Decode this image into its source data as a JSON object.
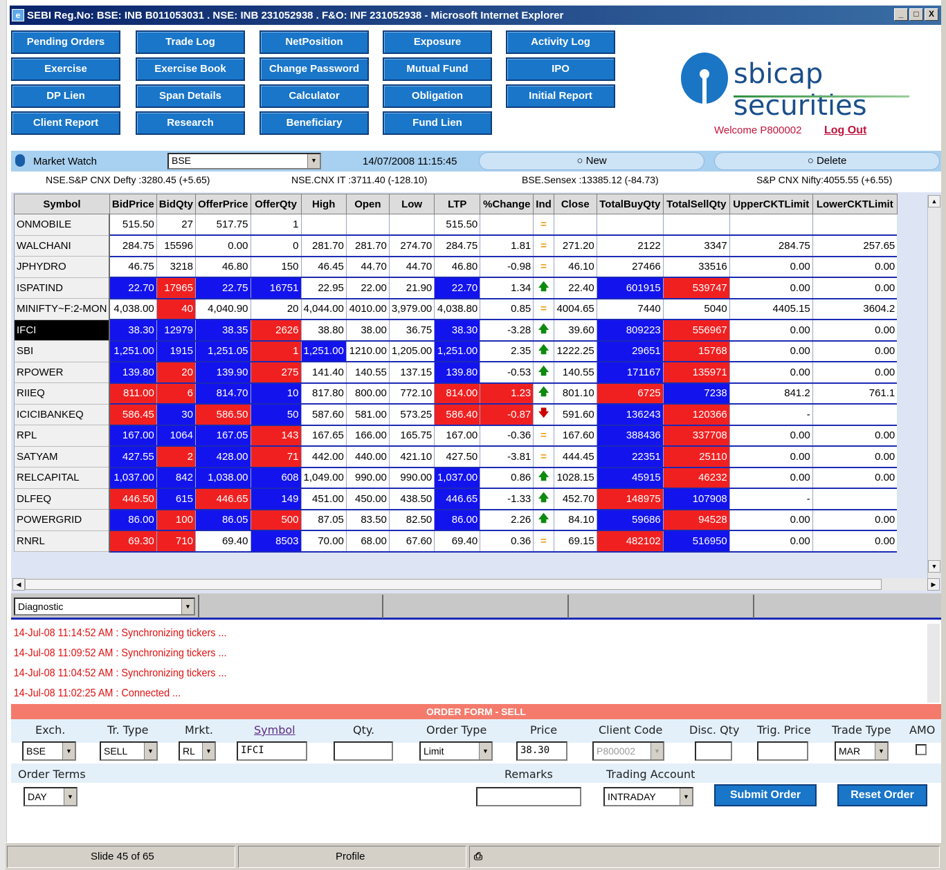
{
  "window": {
    "title": "SEBI Reg.No: BSE: INB B011053031 . NSE: INB 231052938 . F&O: INF 231052938 - Microsoft Internet Explorer",
    "controls": [
      "_",
      "□",
      "X"
    ]
  },
  "nav": {
    "buttons": [
      [
        "Pending Orders",
        "Trade Log",
        "NetPosition",
        "Exposure",
        "Activity Log"
      ],
      [
        "Exercise",
        "Exercise Book",
        "Change Password",
        "Mutual Fund",
        "IPO"
      ],
      [
        "DP Lien",
        "Span Details",
        "Calculator",
        "Obligation",
        "Initial Report"
      ],
      [
        "Client Report",
        "Research",
        "Beneficiary",
        "Fund Lien"
      ]
    ]
  },
  "brand": {
    "name": "sbicap securities"
  },
  "user": {
    "welcome": "Welcome P800002",
    "logout": "Log Out"
  },
  "market_watch": {
    "label": "Market Watch",
    "exchange": "BSE",
    "datetime": "14/07/2008 11:15:45",
    "new": "New",
    "delete": "Delete"
  },
  "indices": [
    "NSE.S&P CNX Defty :3280.45 (+5.65)",
    "NSE.CNX IT :3711.40 (-128.10)",
    "BSE.Sensex :13385.12 (-84.73)",
    "S&P CNX Nifty:4055.55 (+6.55)"
  ],
  "grid": {
    "columns": [
      "Symbol",
      "BidPrice",
      "BidQty",
      "OfferPrice",
      "OfferQty",
      "High",
      "Open",
      "Low",
      "LTP",
      "%Change",
      "Ind",
      "Close",
      "TotalBuyQty",
      "TotalSellQty",
      "UpperCKTLimit",
      "LowerCKTLimit"
    ],
    "rows": [
      [
        "ONMOBILE",
        "515.50",
        "27",
        "517.75",
        "1",
        "",
        "",
        "",
        "515.50",
        "",
        "eq",
        "",
        "",
        "",
        "",
        ""
      ],
      [
        "WALCHANI",
        "284.75",
        "15596",
        "0.00",
        "0",
        "281.70",
        "281.70",
        "274.70",
        "284.75",
        "1.81",
        "eq",
        "271.20",
        "2122",
        "3347",
        "284.75",
        "257.65"
      ],
      [
        "JPHYDRO",
        "46.75",
        "3218",
        "46.80",
        "150",
        "46.45",
        "44.70",
        "44.70",
        "46.80",
        "-0.98",
        "eq",
        "46.10",
        "27466",
        "33516",
        "0.00",
        "0.00"
      ],
      [
        "ISPATIND",
        "22.70",
        "17965",
        "22.75",
        "16751",
        "22.95",
        "22.00",
        "21.90",
        "22.70",
        "1.34",
        "up",
        "22.40",
        "601915",
        "539747",
        "0.00",
        "0.00"
      ],
      [
        "MINIFTY~F:2-MON",
        "4,038.00",
        "40",
        "4,040.90",
        "20",
        "4,044.00",
        "4010.00",
        "3,979.00",
        "4,038.80",
        "0.85",
        "eq",
        "4004.65",
        "7440",
        "5040",
        "4405.15",
        "3604.2"
      ],
      [
        "IFCI",
        "38.30",
        "12979",
        "38.35",
        "2626",
        "38.80",
        "38.00",
        "36.75",
        "38.30",
        "-3.28",
        "up",
        "39.60",
        "809223",
        "556967",
        "0.00",
        "0.00"
      ],
      [
        "SBI",
        "1,251.00",
        "1915",
        "1,251.05",
        "1",
        "1,251.00",
        "1210.00",
        "1,205.00",
        "1,251.00",
        "2.35",
        "up",
        "1222.25",
        "29651",
        "15768",
        "0.00",
        "0.00"
      ],
      [
        "RPOWER",
        "139.80",
        "20",
        "139.90",
        "275",
        "141.40",
        "140.55",
        "137.15",
        "139.80",
        "-0.53",
        "up",
        "140.55",
        "171167",
        "135971",
        "0.00",
        "0.00"
      ],
      [
        "RIIEQ",
        "811.00",
        "6",
        "814.70",
        "10",
        "817.80",
        "800.00",
        "772.10",
        "814.00",
        "1.23",
        "up",
        "801.10",
        "6725",
        "7238",
        "841.2",
        "761.1"
      ],
      [
        "ICICIBANKEQ",
        "586.45",
        "30",
        "586.50",
        "50",
        "587.60",
        "581.00",
        "573.25",
        "586.40",
        "-0.87",
        "dn",
        "591.60",
        "136243",
        "120366",
        "-",
        ""
      ],
      [
        "RPL",
        "167.00",
        "1064",
        "167.05",
        "143",
        "167.65",
        "166.00",
        "165.75",
        "167.00",
        "-0.36",
        "eq",
        "167.60",
        "388436",
        "337708",
        "0.00",
        "0.00"
      ],
      [
        "SATYAM",
        "427.55",
        "2",
        "428.00",
        "71",
        "442.00",
        "440.00",
        "421.10",
        "427.50",
        "-3.81",
        "eq",
        "444.45",
        "22351",
        "25110",
        "0.00",
        "0.00"
      ],
      [
        "RELCAPITAL",
        "1,037.00",
        "842",
        "1,038.00",
        "608",
        "1,049.00",
        "990.00",
        "990.00",
        "1,037.00",
        "0.86",
        "up",
        "1028.15",
        "45915",
        "46232",
        "0.00",
        "0.00"
      ],
      [
        "DLFEQ",
        "446.50",
        "615",
        "446.65",
        "149",
        "451.00",
        "450.00",
        "438.50",
        "446.65",
        "-1.33",
        "up",
        "452.70",
        "148975",
        "107908",
        "-",
        ""
      ],
      [
        "POWERGRID",
        "86.00",
        "100",
        "86.05",
        "500",
        "87.05",
        "83.50",
        "82.50",
        "86.00",
        "2.26",
        "up",
        "84.10",
        "59686",
        "94528",
        "0.00",
        "0.00"
      ],
      [
        "RNRL",
        "69.30",
        "710",
        "69.40",
        "8503",
        "70.00",
        "68.00",
        "67.60",
        "69.40",
        "0.36",
        "eq",
        "69.15",
        "482102",
        "516950",
        "0.00",
        "0.00"
      ]
    ],
    "colors": [
      [
        "",
        "",
        "",
        "",
        "",
        "",
        "",
        "",
        "",
        "",
        "",
        "",
        "",
        "",
        "",
        ""
      ],
      [
        "",
        "",
        "",
        "",
        "",
        "",
        "",
        "",
        "",
        "",
        "",
        "",
        "",
        "",
        "",
        ""
      ],
      [
        "",
        "",
        "",
        "",
        "",
        "",
        "",
        "",
        "",
        "",
        "",
        "",
        "",
        "",
        "",
        ""
      ],
      [
        "",
        "b",
        "r",
        "b",
        "b",
        "",
        "",
        "",
        "b",
        "",
        "",
        "",
        "b",
        "r",
        "",
        ""
      ],
      [
        "",
        "",
        "r",
        "",
        "",
        "",
        "",
        "",
        "",
        "",
        "",
        "",
        "",
        "",
        "",
        ""
      ],
      [
        "s",
        "b",
        "b",
        "b",
        "r",
        "",
        "",
        "",
        "b",
        "",
        "",
        "",
        "b",
        "r",
        "",
        ""
      ],
      [
        "",
        "b",
        "b",
        "b",
        "r",
        "b",
        "",
        "",
        "b",
        "",
        "",
        "",
        "b",
        "r",
        "",
        ""
      ],
      [
        "",
        "b",
        "r",
        "b",
        "r",
        "",
        "",
        "",
        "b",
        "",
        "",
        "",
        "b",
        "r",
        "",
        ""
      ],
      [
        "",
        "r",
        "r",
        "b",
        "b",
        "",
        "",
        "",
        "r",
        "r",
        "",
        "",
        "r",
        "b",
        "",
        ""
      ],
      [
        "",
        "r",
        "b",
        "r",
        "b",
        "",
        "",
        "",
        "r",
        "r",
        "",
        "",
        "b",
        "r",
        "",
        ""
      ],
      [
        "",
        "b",
        "b",
        "b",
        "r",
        "",
        "",
        "",
        "",
        "",
        "",
        "",
        "b",
        "r",
        "",
        ""
      ],
      [
        "",
        "b",
        "r",
        "b",
        "r",
        "",
        "",
        "",
        "",
        "",
        "",
        "",
        "b",
        "r",
        "",
        ""
      ],
      [
        "",
        "b",
        "b",
        "b",
        "b",
        "",
        "",
        "",
        "b",
        "",
        "",
        "",
        "b",
        "r",
        "",
        ""
      ],
      [
        "",
        "r",
        "b",
        "r",
        "b",
        "",
        "",
        "",
        "b",
        "",
        "",
        "",
        "r",
        "b",
        "",
        ""
      ],
      [
        "",
        "b",
        "r",
        "b",
        "r",
        "",
        "",
        "",
        "b",
        "",
        "",
        "",
        "b",
        "r",
        "",
        ""
      ],
      [
        "",
        "r",
        "r",
        "",
        "b",
        "",
        "",
        "",
        "",
        "",
        "",
        "",
        "r",
        "b",
        "",
        ""
      ]
    ]
  },
  "diagnostic": {
    "select": "Diagnostic",
    "log": [
      "14-Jul-08 11:14:52 AM : Synchronizing tickers ...",
      "14-Jul-08 11:09:52 AM : Synchronizing tickers ...",
      "14-Jul-08 11:04:52 AM : Synchronizing tickers ...",
      "14-Jul-08 11:02:25 AM : Connected ..."
    ]
  },
  "order": {
    "header": "ORDER FORM - SELL",
    "labels": {
      "exch": "Exch.",
      "trtype": "Tr. Type",
      "mrkt": "Mrkt.",
      "symbol": "Symbol",
      "qty": "Qty.",
      "ordertype": "Order Type",
      "price": "Price",
      "client": "Client Code",
      "disc": "Disc. Qty",
      "trig": "Trig. Price",
      "tradetype": "Trade Type",
      "amo": "AMO",
      "terms": "Order Terms",
      "remarks": "Remarks",
      "account": "Trading Account"
    },
    "values": {
      "exch": "BSE",
      "trtype": "SELL",
      "mrkt": "RL",
      "symbol": "IFCI",
      "qty": "",
      "ordertype": "Limit",
      "price": "38.30",
      "client": "P800002",
      "disc": "",
      "trig": "",
      "tradetype": "MAR",
      "terms": "DAY",
      "remarks": "",
      "account": "INTRADAY"
    },
    "submit": "Submit Order",
    "reset": "Reset Order"
  },
  "status": {
    "slide": "Slide 45 of 65",
    "profile": "Profile"
  }
}
